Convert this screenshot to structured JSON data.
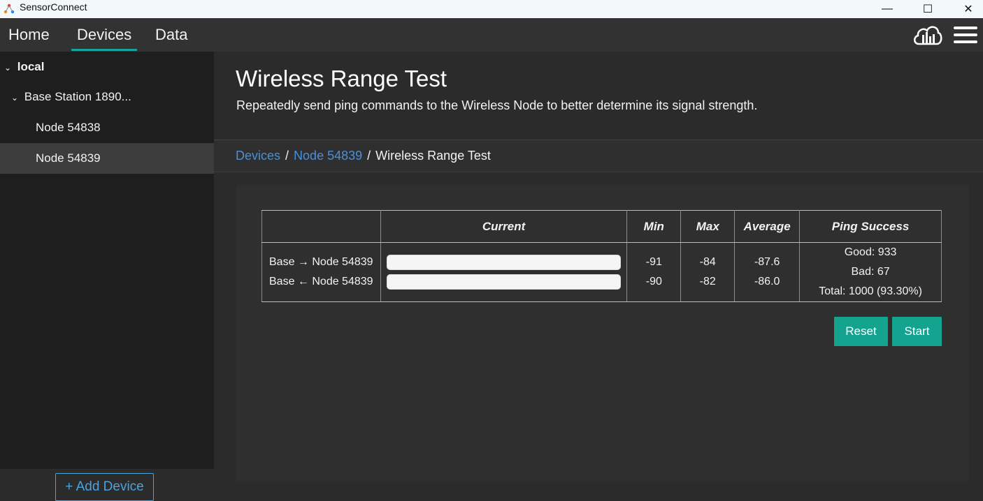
{
  "window": {
    "title": "SensorConnect",
    "controls": {
      "minimize": "—",
      "maximize": "☐",
      "close": "✕"
    }
  },
  "nav": {
    "tabs": [
      "Home",
      "Devices",
      "Data"
    ],
    "active": "Devices"
  },
  "sidebar": {
    "root": {
      "label": "local",
      "expanded": true
    },
    "items": [
      {
        "label": "Base Station 1890...",
        "expanded": true
      },
      {
        "label": "Node 54838"
      },
      {
        "label": "Node 54839",
        "selected": true
      }
    ],
    "add_device": "+ Add Device"
  },
  "header": {
    "title": "Wireless Range Test",
    "subtitle": "Repeatedly send ping commands to the Wireless Node to better determine its signal strength."
  },
  "breadcrumb": [
    "Devices",
    "Node 54839",
    "Wireless Range Test"
  ],
  "table": {
    "headers": [
      "",
      "Current",
      "Min",
      "Max",
      "Average",
      "Ping Success"
    ],
    "rows": [
      {
        "direction": "Base → Node 54839",
        "min": "-91",
        "max": "-84",
        "avg": "-87.6"
      },
      {
        "direction": "Base ← Node 54839",
        "min": "-90",
        "max": "-82",
        "avg": "-86.0"
      }
    ],
    "ping": {
      "good": "Good: 933",
      "bad": "Bad: 67",
      "total": "Total: 1000 (93.30%)"
    }
  },
  "buttons": {
    "reset": "Reset",
    "start": "Start"
  },
  "colors": {
    "accent": "#14a38f",
    "link": "#4a90d9",
    "tab_underline": "#14a39a"
  }
}
